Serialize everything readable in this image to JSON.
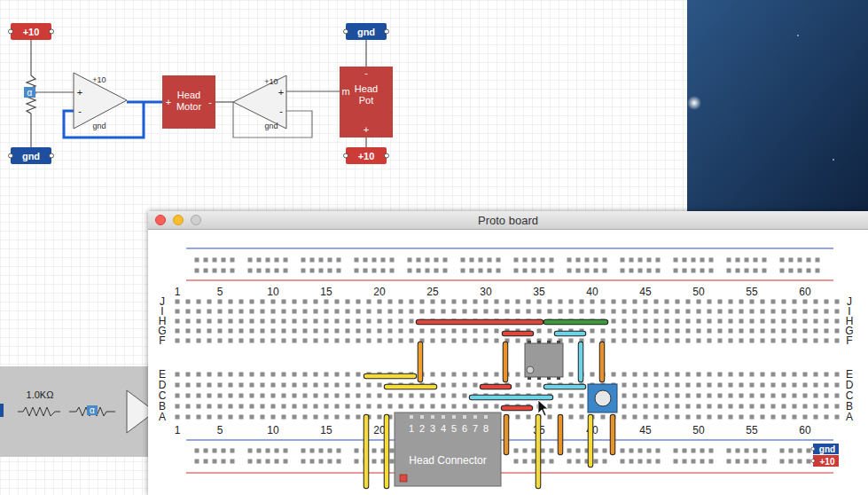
{
  "schematic": {
    "labels": [
      {
        "text": "+10",
        "kind": "power"
      },
      {
        "text": "gnd",
        "kind": "ground"
      },
      {
        "text": "gnd",
        "kind": "ground"
      },
      {
        "text": "+10",
        "kind": "power"
      }
    ],
    "pot_symbol": "α",
    "opamps": [
      {
        "supply": "+10",
        "ground": "gnd",
        "plus": "+",
        "minus": "-"
      },
      {
        "supply": "+10",
        "ground": "gnd",
        "plus": "+",
        "minus": "-"
      }
    ],
    "head_motor": {
      "label": [
        "Head",
        "Motor"
      ],
      "plus": "+",
      "minus": "-"
    },
    "head_pot": {
      "label": [
        "Head",
        "Pot"
      ],
      "minus": "-",
      "plus": "+",
      "wiper": "m"
    }
  },
  "palette": {
    "resistor_value": "1.0KΩ",
    "pot_symbol": "α"
  },
  "window": {
    "title": "Proto board"
  },
  "breadboard": {
    "column_numbers": [
      "1",
      "5",
      "10",
      "15",
      "20",
      "25",
      "30",
      "35",
      "40",
      "45",
      "50",
      "55",
      "60"
    ],
    "rows_upper": [
      "J",
      "I",
      "H",
      "G",
      "F"
    ],
    "rows_lower": [
      "E",
      "D",
      "C",
      "B",
      "A"
    ],
    "connector": {
      "label": "Head Connector",
      "pins": [
        "1",
        "2",
        "3",
        "4",
        "5",
        "6",
        "7",
        "8"
      ]
    },
    "rails": [
      {
        "text": "gnd",
        "kind": "ground"
      },
      {
        "text": "+10",
        "kind": "power"
      }
    ],
    "wires": [
      {
        "color": "#e0483d"
      },
      {
        "color": "#3c9a3c"
      },
      {
        "color": "#e0483d"
      },
      {
        "color": "#6fd3e8"
      },
      {
        "color": "#f5dc3c"
      },
      {
        "color": "#f5dc3c"
      },
      {
        "color": "#e0483d"
      },
      {
        "color": "#6fd3e8"
      },
      {
        "color": "#6fd3e8"
      },
      {
        "color": "#e0483d"
      },
      {
        "color": "#f0a030"
      },
      {
        "color": "#e8922b"
      },
      {
        "color": "#e8922b"
      },
      {
        "color": "#6fd3e8"
      },
      {
        "color": "#f5dc3c"
      },
      {
        "color": "#f5dc3c"
      },
      {
        "color": "#e8922b"
      },
      {
        "color": "#f5dc3c"
      },
      {
        "color": "#e8922b"
      },
      {
        "color": "#f5dc3c"
      },
      {
        "color": "#e8922b"
      }
    ]
  }
}
